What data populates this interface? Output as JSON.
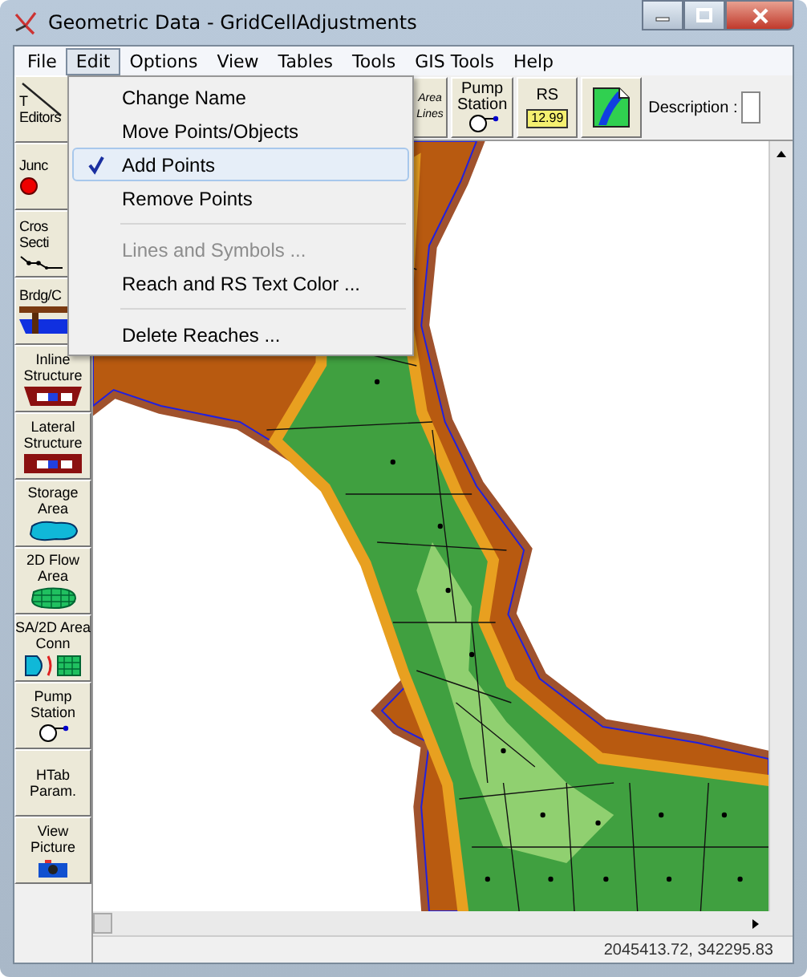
{
  "window": {
    "title": "Geometric Data - GridCellAdjustments"
  },
  "menu_bar": [
    {
      "label": "File",
      "selected": false
    },
    {
      "label": "Edit",
      "selected": true
    },
    {
      "label": "Options",
      "selected": false
    },
    {
      "label": "View",
      "selected": false
    },
    {
      "label": "Tables",
      "selected": false
    },
    {
      "label": "Tools",
      "selected": false
    },
    {
      "label": "GIS Tools",
      "selected": false
    },
    {
      "label": "Help",
      "selected": false
    }
  ],
  "edit_menu": [
    {
      "kind": "item",
      "label": "Change Name",
      "checked": false,
      "disabled": false,
      "selected": false
    },
    {
      "kind": "item",
      "label": "Move Points/Objects",
      "checked": false,
      "disabled": false,
      "selected": false
    },
    {
      "kind": "item",
      "label": "Add Points",
      "checked": true,
      "disabled": false,
      "selected": true
    },
    {
      "kind": "item",
      "label": "Remove Points",
      "checked": false,
      "disabled": false,
      "selected": false
    },
    {
      "kind": "separator"
    },
    {
      "kind": "item",
      "label": "Lines and Symbols ...",
      "checked": false,
      "disabled": true,
      "selected": false
    },
    {
      "kind": "item",
      "label": "Reach and RS Text Color ...",
      "checked": false,
      "disabled": false,
      "selected": false
    },
    {
      "kind": "separator"
    },
    {
      "kind": "item",
      "label": "Delete Reaches ...",
      "checked": false,
      "disabled": false,
      "selected": false
    }
  ],
  "left_toolbar": [
    {
      "kind": "editors",
      "lines": [
        "T",
        "Editors"
      ]
    },
    {
      "kind": "junction",
      "lines": [
        "Junc"
      ]
    },
    {
      "kind": "cross-section",
      "lines": [
        "Cros",
        "Secti"
      ]
    },
    {
      "kind": "bridge",
      "lines": [
        "Brdg/C"
      ]
    },
    {
      "kind": "inline",
      "lines": [
        "Inline",
        "Structure"
      ]
    },
    {
      "kind": "lateral",
      "lines": [
        "Lateral",
        "Structure"
      ]
    },
    {
      "kind": "storage",
      "lines": [
        "Storage",
        "Area"
      ]
    },
    {
      "kind": "flow2d",
      "lines": [
        "2D Flow",
        "Area"
      ]
    },
    {
      "kind": "conn",
      "lines": [
        "SA/2D Area",
        "Conn"
      ]
    },
    {
      "kind": "pump",
      "lines": [
        "Pump",
        "Station"
      ]
    },
    {
      "kind": "text",
      "lines": [
        "HTab",
        "Param."
      ]
    },
    {
      "kind": "picture",
      "lines": [
        "View",
        "Picture"
      ]
    }
  ],
  "top_toolbar": [
    {
      "kind": "area-lines",
      "lines": [
        "Area",
        "Lines"
      ]
    },
    {
      "kind": "pump",
      "lines": [
        "Pump",
        "Station"
      ]
    },
    {
      "kind": "rs",
      "lines": [
        "RS"
      ],
      "tag": "12.99"
    },
    {
      "kind": "gis"
    }
  ],
  "description": {
    "label": "Description :"
  },
  "status_bar": {
    "coordinates": "2045413.72, 342295.83"
  }
}
